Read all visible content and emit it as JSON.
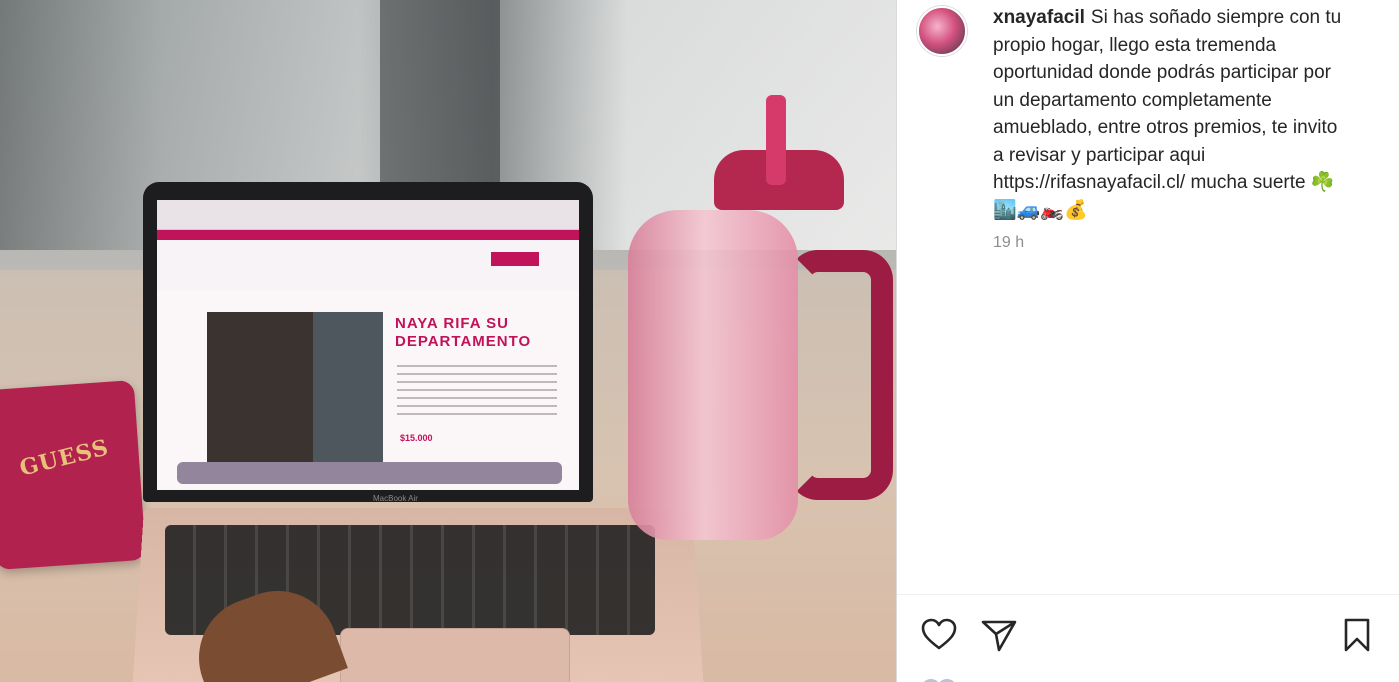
{
  "post": {
    "username": "xnayafacil",
    "caption": "Si has soñado siempre con tu propio hogar, llego esta tremenda oportunidad donde podrás participar por un departamento completamente amueblado, entre otros premios, te invito a revisar y participar aqui https://rifasnayafacil.cl/ mucha suerte ☘️🏙️🚙🏍️💰",
    "timestamp": "19 h"
  },
  "media": {
    "laptop_screen_title": "NAYA RIFA SU DEPARTAMENTO",
    "laptop_screen_price": "$15.000",
    "wallet_brand": "GUESS",
    "laptop_model": "MacBook Air"
  },
  "icons": {
    "like": "heart-icon",
    "share": "paper-plane-icon",
    "save": "bookmark-icon"
  }
}
